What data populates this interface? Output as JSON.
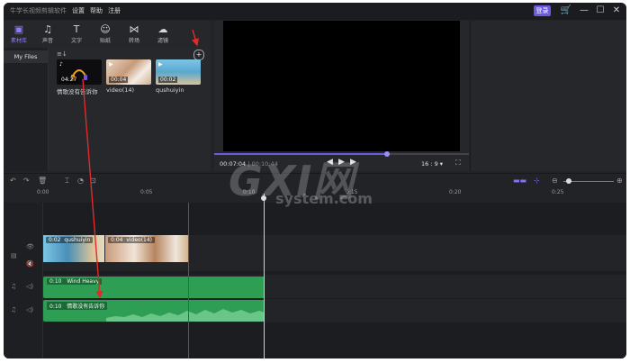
{
  "titlebar": {
    "app_title": "牛学长视频剪辑软件",
    "menus": [
      "设置",
      "帮助",
      "注册"
    ],
    "login": "登录"
  },
  "toolbar": {
    "tools": [
      {
        "label": "素材库",
        "icon": "media-icon"
      },
      {
        "label": "声音",
        "icon": "music-icon"
      },
      {
        "label": "文字",
        "icon": "text-icon"
      },
      {
        "label": "贴纸",
        "icon": "sticker-icon"
      },
      {
        "label": "转场",
        "icon": "transition-icon"
      },
      {
        "label": "滤镜",
        "icon": "filter-icon"
      }
    ]
  },
  "sidebar": {
    "my_files": "My Files"
  },
  "media": {
    "items": [
      {
        "name": "情歌没有告诉你",
        "duration": "04:27",
        "kind": "audio"
      },
      {
        "name": "video(14)",
        "duration": "00:04",
        "kind": "video"
      },
      {
        "name": "qushuiyin",
        "duration": "00:02",
        "kind": "video"
      }
    ]
  },
  "preview": {
    "current_time": "00:07:04",
    "total_time": "00:10:44",
    "aspect_ratio": "16 : 9",
    "progress": 0.68
  },
  "ruler": {
    "ticks": [
      "0:00",
      "0:05",
      "0:10",
      "0:15",
      "0:20",
      "0:25"
    ]
  },
  "timeline": {
    "video_clips": [
      {
        "time": "0:02",
        "name": "qushuiyin"
      },
      {
        "time": "0:04",
        "name": "video(14)"
      }
    ],
    "audio_tracks": [
      {
        "time": "0:10",
        "name": "Wind Heavy"
      },
      {
        "time": "0:10",
        "name": "情歌没有告诉你"
      }
    ]
  },
  "watermark": {
    "big": "GXI网",
    "small": "system.com"
  },
  "colors": {
    "accent": "#6a5ae0",
    "audio_clip": "#2f9e55",
    "arrow": "#e02a2a"
  }
}
